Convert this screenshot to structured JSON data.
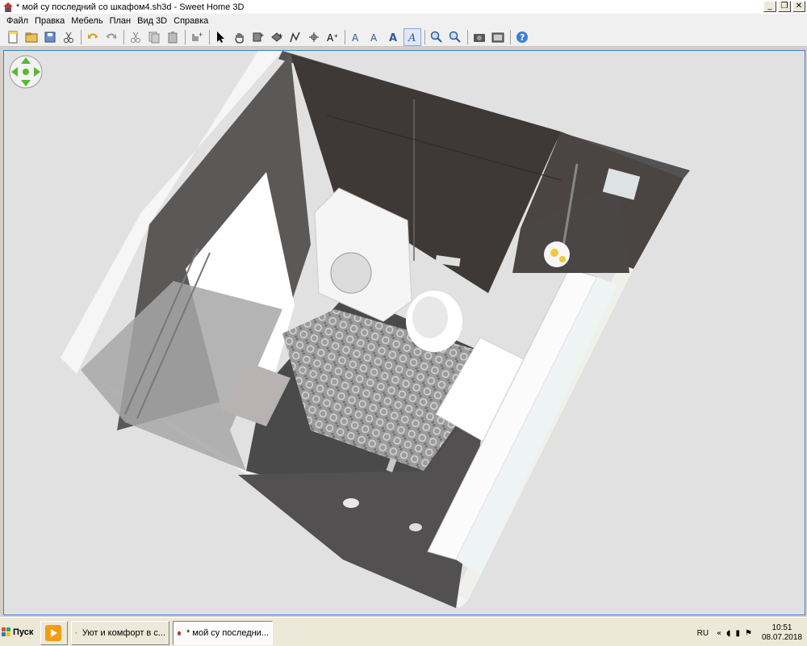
{
  "window": {
    "title": "* мой су последний со шкафом4.sh3d - Sweet Home 3D",
    "buttons": {
      "minimize": "_",
      "maximize": "❐",
      "close": "✕"
    }
  },
  "menu": [
    "Файл",
    "Правка",
    "Мебель",
    "План",
    "Вид 3D",
    "Справка"
  ],
  "toolbar_icons": [
    "new-icon",
    "open-icon",
    "save-icon",
    "cut-icon",
    "undo-icon",
    "redo-icon",
    "scissors-icon",
    "copy-icon",
    "paste-icon",
    "add-furniture-icon",
    "select-icon",
    "pan-icon",
    "create-walls-icon",
    "create-rooms-icon",
    "create-polylines-icon",
    "create-dimensions-icon",
    "add-text-icon",
    "text-style-icon",
    "increase-text-icon",
    "decrease-text-icon",
    "bold-icon",
    "italic-icon",
    "zoom-in-icon",
    "zoom-out-icon",
    "photo-icon",
    "video-icon",
    "help-icon"
  ],
  "taskbar": {
    "start": "Пуск",
    "tasks": [
      {
        "label": ""
      },
      {
        "label": "Уют и комфорт в с..."
      },
      {
        "label": "* мой су последни..."
      }
    ],
    "lang": "RU",
    "time": "10:51",
    "date": "08.07.2018"
  },
  "colors": {
    "viewport_bg": "#e1e1e1",
    "floor": "#4a4a4a",
    "tiles": "#9a9a9a",
    "wall_dark": "#3e3937",
    "accent": "#3c7fd6"
  }
}
